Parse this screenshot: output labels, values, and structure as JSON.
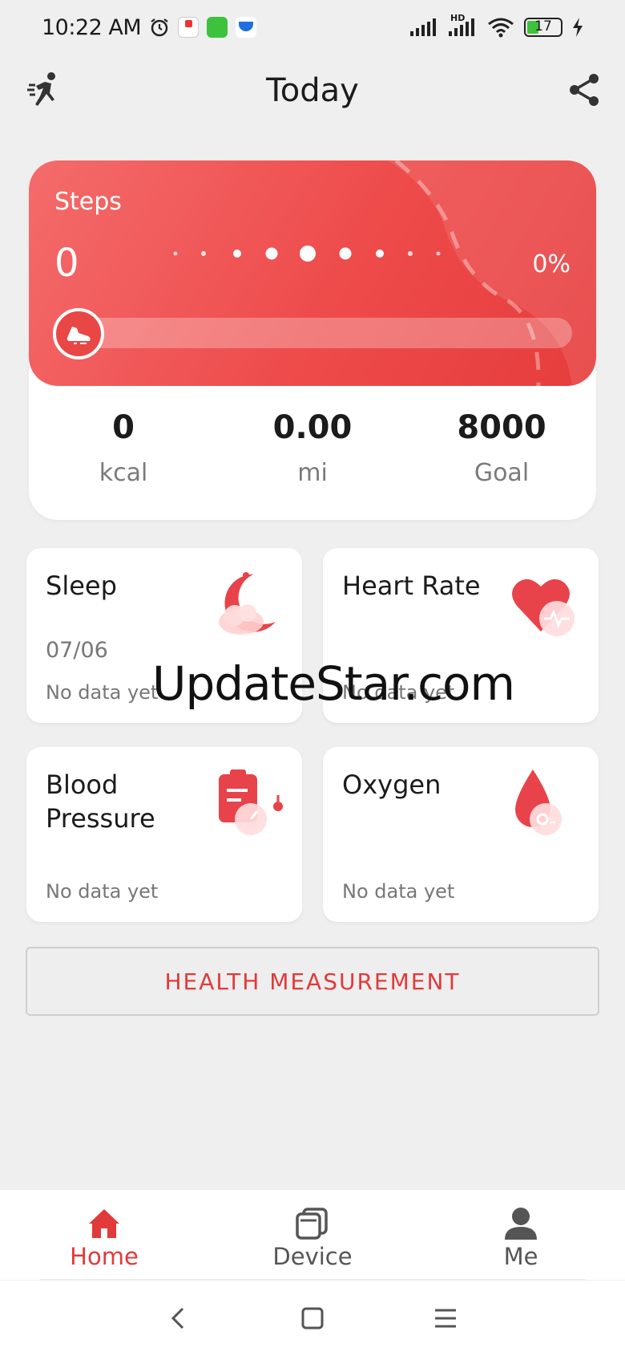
{
  "status_bar": {
    "time": "10:22 AM",
    "battery": "17",
    "network": "HD"
  },
  "header": {
    "title": "Today",
    "left_icon": "running-icon",
    "right_icon": "share-icon"
  },
  "steps": {
    "label": "Steps",
    "value": "0",
    "percent": "0%",
    "progress": 0,
    "stats": [
      {
        "value": "0",
        "label": "kcal"
      },
      {
        "value": "0.00",
        "label": "mi"
      },
      {
        "value": "8000",
        "label": "Goal"
      }
    ]
  },
  "tiles": {
    "sleep": {
      "title": "Sleep",
      "date": "07/06",
      "status": "No data yet",
      "icon": "moon-cloud-icon"
    },
    "heart_rate": {
      "title": "Heart Rate",
      "status": "No data yet",
      "icon": "heart-icon"
    },
    "blood_pressure": {
      "title_line1": "Blood",
      "title_line2": "Pressure",
      "status": "No data yet",
      "icon": "clipboard-gauge-icon"
    },
    "oxygen": {
      "title": "Oxygen",
      "status": "No data yet",
      "icon": "blood-drop-icon"
    }
  },
  "measure_button": "HEALTH MEASUREMENT",
  "watermark": "UpdateStar.com",
  "bottom_nav": [
    {
      "label": "Home",
      "icon": "home-icon",
      "active": true
    },
    {
      "label": "Device",
      "icon": "device-icon",
      "active": false
    },
    {
      "label": "Me",
      "icon": "person-icon",
      "active": false
    }
  ],
  "colors": {
    "accent": "#e13a3a",
    "card_gradient_start": "#f46b6b",
    "card_gradient_end": "#e63c3c",
    "background": "#efefef"
  }
}
